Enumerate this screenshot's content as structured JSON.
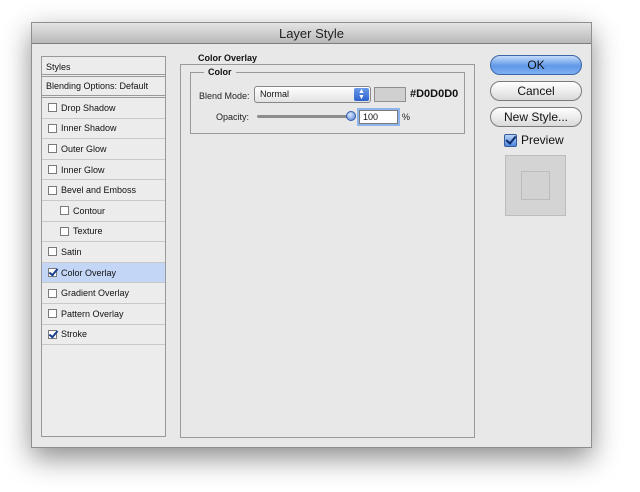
{
  "window": {
    "title": "Layer Style"
  },
  "styles": {
    "header": "Styles",
    "blending_options": "Blending Options: Default",
    "items": [
      {
        "label": "Drop Shadow",
        "checked": false,
        "sub": false,
        "selected": false
      },
      {
        "label": "Inner Shadow",
        "checked": false,
        "sub": false,
        "selected": false
      },
      {
        "label": "Outer Glow",
        "checked": false,
        "sub": false,
        "selected": false
      },
      {
        "label": "Inner Glow",
        "checked": false,
        "sub": false,
        "selected": false
      },
      {
        "label": "Bevel and Emboss",
        "checked": false,
        "sub": false,
        "selected": false
      },
      {
        "label": "Contour",
        "checked": false,
        "sub": true,
        "selected": false
      },
      {
        "label": "Texture",
        "checked": false,
        "sub": true,
        "selected": false
      },
      {
        "label": "Satin",
        "checked": false,
        "sub": false,
        "selected": false
      },
      {
        "label": "Color Overlay",
        "checked": true,
        "sub": false,
        "selected": true
      },
      {
        "label": "Gradient Overlay",
        "checked": false,
        "sub": false,
        "selected": false
      },
      {
        "label": "Pattern Overlay",
        "checked": false,
        "sub": false,
        "selected": false
      },
      {
        "label": "Stroke",
        "checked": true,
        "sub": false,
        "selected": false
      }
    ]
  },
  "panel": {
    "title": "Color Overlay",
    "group_title": "Color",
    "blend_mode_label": "Blend Mode:",
    "blend_mode_value": "Normal",
    "color_hex": "#D0D0D0",
    "opacity_label": "Opacity:",
    "opacity_value": "100",
    "opacity_unit": "%"
  },
  "buttons": {
    "ok": "OK",
    "cancel": "Cancel",
    "new_style": "New Style..."
  },
  "preview": {
    "label": "Preview",
    "checked": true
  },
  "colors": {
    "overlay_color": "#D0D0D0",
    "selection_bg": "#C3D6F5",
    "window_bg": "#E8E8E8"
  }
}
